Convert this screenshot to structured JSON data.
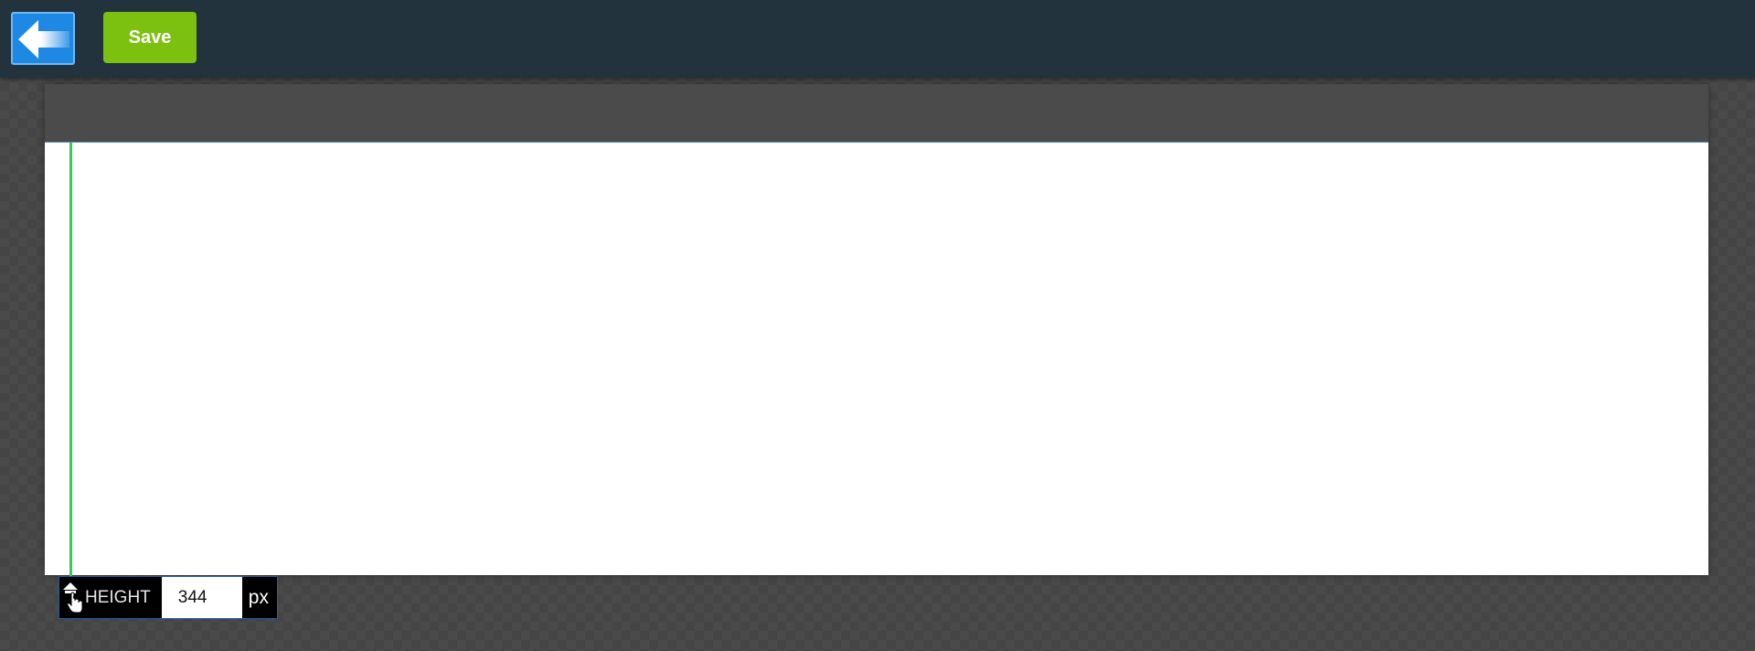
{
  "toolbar": {
    "back_icon": "arrow-left-icon",
    "save_label": "Save"
  },
  "height_control": {
    "handle_icon": "resize-vertical-icon",
    "label": "HEIGHT",
    "value": "344",
    "unit": "px"
  },
  "colors": {
    "toolbar_bg": "#22333d",
    "back_button": "#1e88e5",
    "save_button": "#7cc110",
    "guide_line": "#2fd04f",
    "canvas_bg": "#ffffff"
  }
}
